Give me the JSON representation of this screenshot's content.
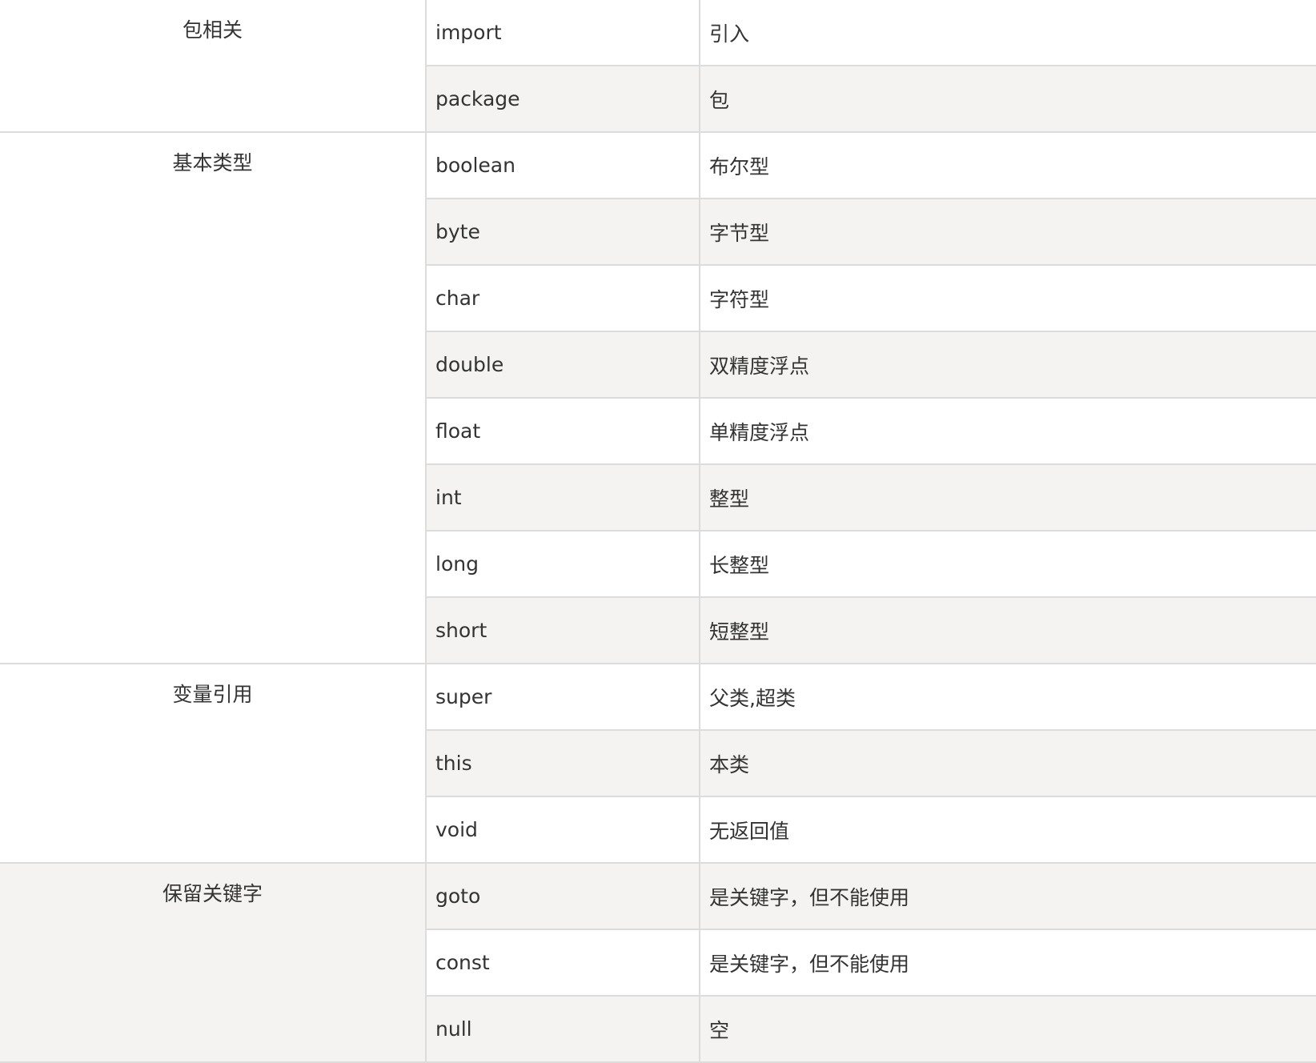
{
  "table": {
    "groups": [
      {
        "category": "包相关",
        "shaded": false,
        "rows": [
          {
            "keyword": "import",
            "meaning": "引入"
          },
          {
            "keyword": "package",
            "meaning": "包"
          }
        ]
      },
      {
        "category": "基本类型",
        "shaded": false,
        "rows": [
          {
            "keyword": "boolean",
            "meaning": "布尔型"
          },
          {
            "keyword": "byte",
            "meaning": "字节型"
          },
          {
            "keyword": "char",
            "meaning": "字符型"
          },
          {
            "keyword": "double",
            "meaning": "双精度浮点"
          },
          {
            "keyword": "float",
            "meaning": "单精度浮点"
          },
          {
            "keyword": "int",
            "meaning": "整型"
          },
          {
            "keyword": "long",
            "meaning": "长整型"
          },
          {
            "keyword": "short",
            "meaning": "短整型"
          }
        ]
      },
      {
        "category": "变量引用",
        "shaded": false,
        "rows": [
          {
            "keyword": "super",
            "meaning": "父类,超类"
          },
          {
            "keyword": "this",
            "meaning": "本类"
          },
          {
            "keyword": "void",
            "meaning": "无返回值"
          }
        ]
      },
      {
        "category": "保留关键字",
        "shaded": true,
        "rows": [
          {
            "keyword": "goto",
            "meaning": "是关键字，但不能使用"
          },
          {
            "keyword": "const",
            "meaning": "是关键字，但不能使用"
          },
          {
            "keyword": "null",
            "meaning": "空"
          }
        ]
      }
    ]
  }
}
